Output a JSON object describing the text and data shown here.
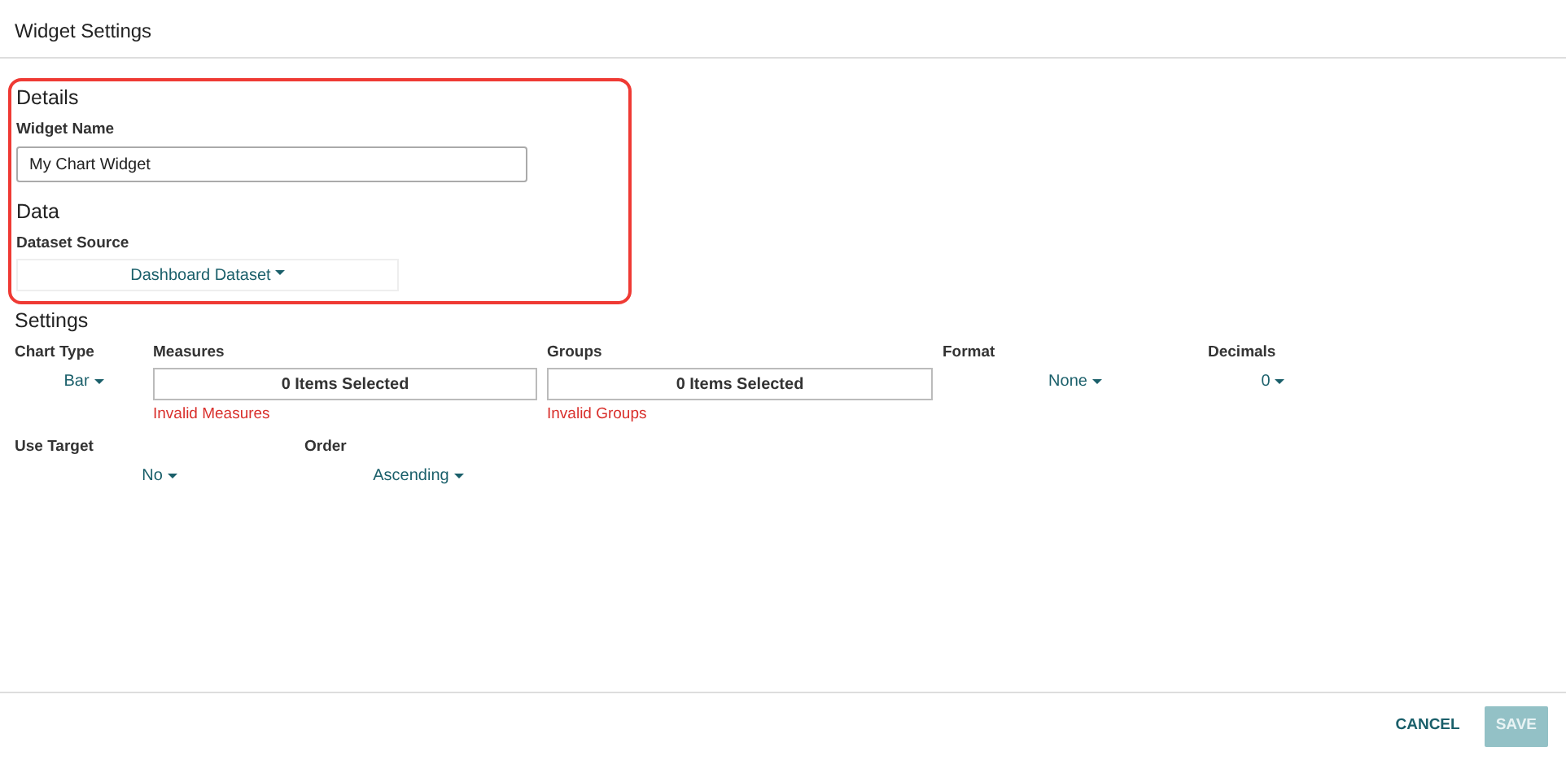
{
  "header": {
    "title": "Widget Settings"
  },
  "highlight": {
    "on": true
  },
  "details": {
    "title": "Details",
    "label": "Widget Name",
    "value": "My Chart Widget"
  },
  "data": {
    "title": "Data",
    "label": "Dataset Source",
    "value": "Dashboard Dataset"
  },
  "settings": {
    "title": "Settings",
    "rows": [
      [
        {
          "label": "Chart Type",
          "kind": "dropdown",
          "value": "Bar"
        },
        {
          "label": "Measures",
          "kind": "multiselect",
          "value": "0 Items Selected",
          "error": "Invalid Measures"
        },
        {
          "label": "Groups",
          "kind": "multiselect",
          "value": "0 Items Selected",
          "error": "Invalid Groups"
        },
        {
          "label": "Format",
          "kind": "dropdown",
          "value": "None"
        },
        {
          "label": "Decimals",
          "kind": "dropdown",
          "value": "0"
        }
      ],
      [
        {
          "label": "Use Target",
          "kind": "dropdown",
          "value": "No"
        },
        {
          "label": "Order",
          "kind": "dropdown",
          "value": "Ascending"
        }
      ]
    ]
  },
  "footer": {
    "buttons": [
      {
        "label": "CANCEL",
        "kind": "text",
        "disabled": false
      },
      {
        "label": "SAVE",
        "kind": "filled",
        "disabled": true
      }
    ]
  }
}
